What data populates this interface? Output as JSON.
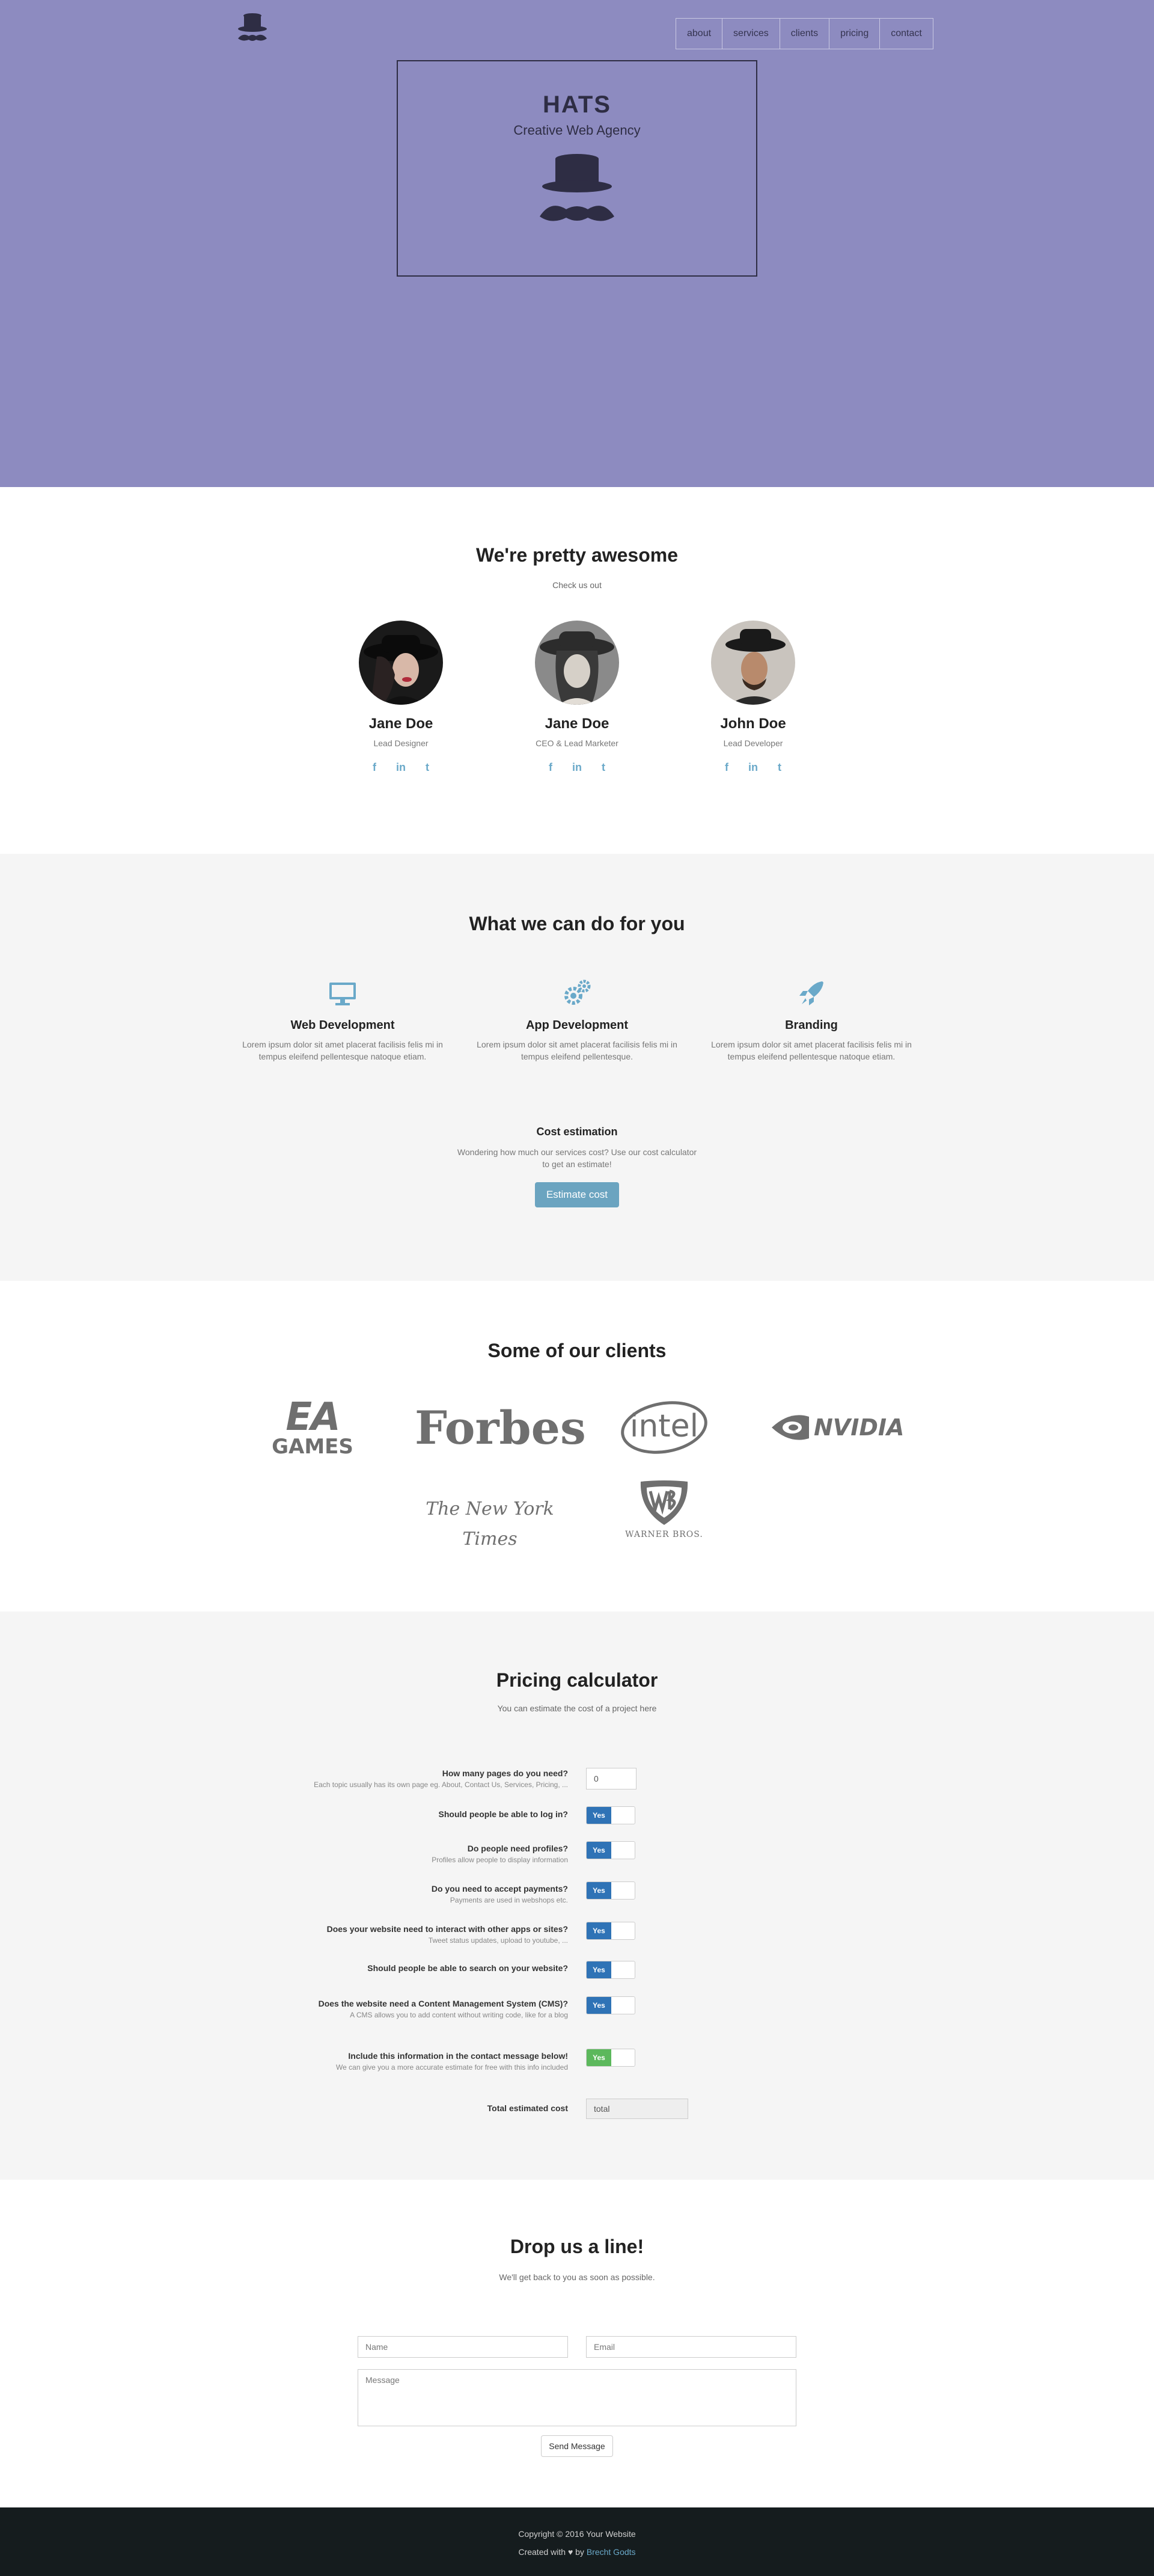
{
  "nav": {
    "items": [
      "about",
      "services",
      "clients",
      "pricing",
      "contact"
    ]
  },
  "hero": {
    "title": "HATS",
    "subtitle": "Creative Web Agency",
    "bg_color": "#8d8bc0"
  },
  "team": {
    "title": "We're pretty awesome",
    "subtitle": "Check us out",
    "members": [
      {
        "name": "Jane Doe",
        "role": "Lead Designer"
      },
      {
        "name": "Jane Doe",
        "role": "CEO & Lead Marketer"
      },
      {
        "name": "John Doe",
        "role": "Lead Developer"
      }
    ],
    "social_icons": [
      "facebook-icon",
      "linkedin-icon",
      "twitter-icon"
    ],
    "social_glyphs": [
      "f",
      "in",
      "t"
    ]
  },
  "services": {
    "title": "What we can do for you",
    "items": [
      {
        "icon": "monitor-icon",
        "title": "Web Development",
        "text": "Lorem ipsum dolor sit amet placerat facilisis felis mi in tempus eleifend pellentesque natoque etiam."
      },
      {
        "icon": "gears-icon",
        "title": "App Development",
        "text": "Lorem ipsum dolor sit amet placerat facilisis felis mi in tempus eleifend pellentesque."
      },
      {
        "icon": "rocket-icon",
        "title": "Branding",
        "text": "Lorem ipsum dolor sit amet placerat facilisis felis mi in tempus eleifend pellentesque natoque etiam."
      }
    ],
    "cost": {
      "title": "Cost estimation",
      "text": "Wondering how much our services cost? Use our cost calculator to get an estimate!",
      "button": "Estimate cost"
    },
    "accent_color": "#6aa9c9"
  },
  "clients": {
    "title": "Some of our clients",
    "logos": [
      "EA",
      "GAMES",
      "Forbes",
      "intel",
      "NVIDIA",
      "The New York Times",
      "WARNER BROS."
    ]
  },
  "pricing": {
    "title": "Pricing calculator",
    "subtitle": "You can estimate the cost of a project here",
    "questions": [
      {
        "label": "How many pages do you need?",
        "hint": "Each topic usually has its own page eg. About, Contact Us, Services, Pricing, ...",
        "input": "0"
      },
      {
        "label": "Should people be able to log in?",
        "hint": "",
        "toggle": "Yes"
      },
      {
        "label": "Do people need profiles?",
        "hint": "Profiles allow people to display information",
        "toggle": "Yes"
      },
      {
        "label": "Do you need to accept payments?",
        "hint": "Payments are used in webshops etc.",
        "toggle": "Yes"
      },
      {
        "label": "Does your website need to interact with other apps or sites?",
        "hint": "Tweet status updates, upload to youtube, ...",
        "toggle": "Yes"
      },
      {
        "label": "Should people be able to search on your website?",
        "hint": "",
        "toggle": "Yes"
      },
      {
        "label": "Does the website need a Content Management System (CMS)?",
        "hint": "A CMS allows you to add content without writing code, like for a blog",
        "toggle": "Yes"
      }
    ],
    "include": {
      "label": "Include this information in the contact message below!",
      "hint": "We can give you a more accurate estimate for free with this info included",
      "toggle": "Yes"
    },
    "total": {
      "label": "Total estimated cost",
      "value": "total"
    }
  },
  "contact": {
    "title": "Drop us a line!",
    "subtitle": "We'll get back to you as soon as possible.",
    "name_placeholder": "Name",
    "email_placeholder": "Email",
    "message_placeholder": "Message",
    "button": "Send Message"
  },
  "footer": {
    "copyright": "Copyright © 2016 Your Website",
    "created_prefix": "Created with",
    "created_by": "by",
    "author": "Brecht Godts"
  }
}
